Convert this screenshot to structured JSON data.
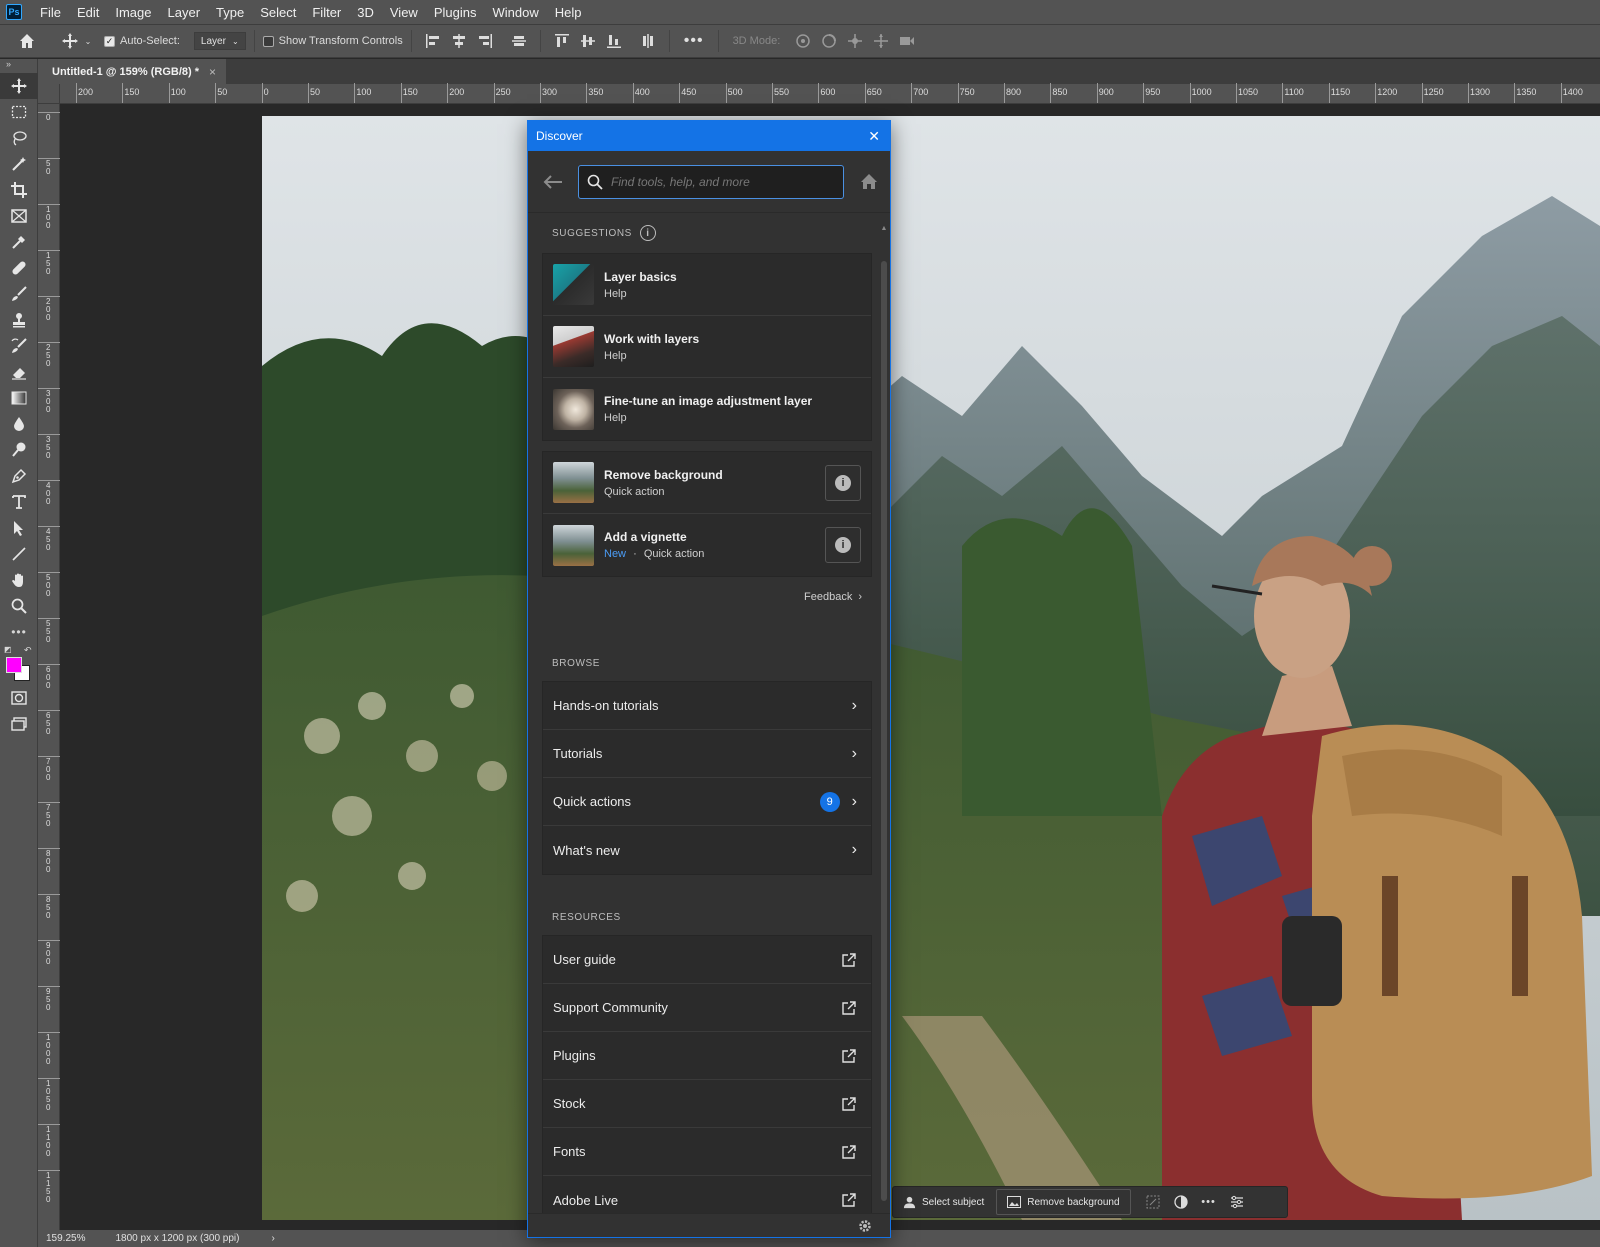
{
  "menubar": {
    "logo": "Ps",
    "items": [
      "File",
      "Edit",
      "Image",
      "Layer",
      "Type",
      "Select",
      "Filter",
      "3D",
      "View",
      "Plugins",
      "Window",
      "Help"
    ]
  },
  "options": {
    "auto_select_label": "Auto-Select:",
    "auto_select_checked": true,
    "layer_select_value": "Layer",
    "show_transform_label": "Show Transform Controls",
    "mode_3d_label": "3D Mode:"
  },
  "document_tab": {
    "title": "Untitled-1 @ 159% (RGB/8) *",
    "close_glyph": "×"
  },
  "ruler": {
    "h_labels": [
      "200",
      "150",
      "100",
      "50",
      "0",
      "50",
      "100",
      "150",
      "200",
      "250",
      "300",
      "350",
      "400",
      "450",
      "500",
      "550",
      "600",
      "650",
      "700",
      "750",
      "800",
      "850",
      "900",
      "950",
      "1000",
      "1050",
      "1100",
      "1150",
      "1200",
      "1250",
      "1300",
      "1350",
      "1400"
    ],
    "v_labels": [
      "0",
      "5 0",
      "1 0 0",
      "1 5 0",
      "2 0 0",
      "2 5 0",
      "3 0 0",
      "3 5 0",
      "4 0 0",
      "4 5 0",
      "5 0 0",
      "5 5 0",
      "6 0 0",
      "6 5 0",
      "7 0 0",
      "7 5 0",
      "8 0 0",
      "8 5 0",
      "9 0 0",
      "9 5 0",
      "1 0 0 0",
      "1 0 5 0",
      "1 1 0 0",
      "1 1 5 0"
    ]
  },
  "colors": {
    "foreground": "#ff00ff",
    "background": "#ffffff",
    "accent": "#1473e6"
  },
  "statusbar": {
    "zoom": "159.25%",
    "doc_size": "1800 px x 1200 px (300 ppi)",
    "arrow": "›"
  },
  "context_bar": {
    "select_subject": "Select subject",
    "remove_background": "Remove background"
  },
  "discover": {
    "title": "Discover",
    "close_glyph": "✕",
    "search_placeholder": "Find tools, help, and more",
    "suggestions_label": "SUGGESTIONS",
    "suggestions": [
      {
        "title": "Layer basics",
        "subtitle": "Help",
        "new": "",
        "has_info": false
      },
      {
        "title": "Work with layers",
        "subtitle": "Help",
        "new": "",
        "has_info": false
      },
      {
        "title": "Fine-tune an image adjustment layer",
        "subtitle": "Help",
        "new": "",
        "has_info": false
      }
    ],
    "quick_actions": [
      {
        "title": "Remove background",
        "subtitle": "Quick action",
        "new": "",
        "has_info": true
      },
      {
        "title": "Add a vignette",
        "subtitle": "Quick action",
        "new": "New",
        "dot": "·",
        "has_info": true
      }
    ],
    "feedback_label": "Feedback",
    "browse_label": "BROWSE",
    "browse": [
      {
        "label": "Hands-on tutorials",
        "badge": ""
      },
      {
        "label": "Tutorials",
        "badge": ""
      },
      {
        "label": "Quick actions",
        "badge": "9"
      },
      {
        "label": "What's new",
        "badge": ""
      }
    ],
    "resources_label": "RESOURCES",
    "resources": [
      "User guide",
      "Support Community",
      "Plugins",
      "Stock",
      "Fonts",
      "Adobe Live"
    ]
  }
}
